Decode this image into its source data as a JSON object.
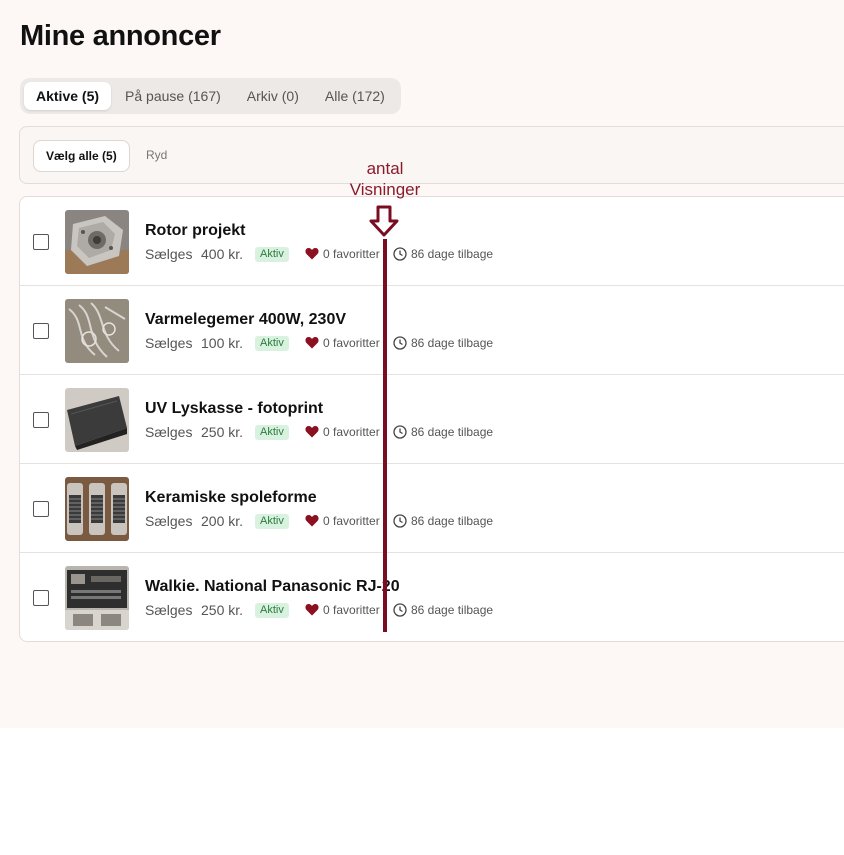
{
  "page": {
    "title": "Mine annoncer"
  },
  "tabs": [
    {
      "label": "Aktive (5)",
      "active": true
    },
    {
      "label": "På pause (167)",
      "active": false
    },
    {
      "label": "Arkiv (0)",
      "active": false
    },
    {
      "label": "Alle (172)",
      "active": false
    }
  ],
  "toolbar": {
    "select_all_label": "Vælg alle (5)",
    "clear_label": "Ryd"
  },
  "listings": [
    {
      "title": "Rotor projekt",
      "type": "Sælges",
      "price": "400 kr.",
      "status": "Aktiv",
      "favorites": "0 favoritter",
      "age": "86 dage tilbage"
    },
    {
      "title": "Varmelegemer 400W, 230V",
      "type": "Sælges",
      "price": "100 kr.",
      "status": "Aktiv",
      "favorites": "0 favoritter",
      "age": "86 dage tilbage"
    },
    {
      "title": "UV Lyskasse - fotoprint",
      "type": "Sælges",
      "price": "250 kr.",
      "status": "Aktiv",
      "favorites": "0 favoritter",
      "age": "86 dage tilbage"
    },
    {
      "title": "Keramiske spoleforme",
      "type": "Sælges",
      "price": "200 kr.",
      "status": "Aktiv",
      "favorites": "0 favoritter",
      "age": "86 dage tilbage"
    },
    {
      "title": "Walkie. National Panasonic RJ-20",
      "type": "Sælges",
      "price": "250 kr.",
      "status": "Aktiv",
      "favorites": "0 favoritter",
      "age": "86 dage tilbage"
    }
  ],
  "annotation": {
    "line1": "antal",
    "line2": "Visninger"
  },
  "colors": {
    "page_bg": "#fdf8f5",
    "badge_bg": "#d9f2df",
    "badge_text": "#2b7a3f",
    "heart": "#8b1020",
    "annotation": "#8b1a2c"
  },
  "icons": {
    "favorites": "heart-icon",
    "age": "clock-icon",
    "annotation": "down-arrow-icon"
  }
}
